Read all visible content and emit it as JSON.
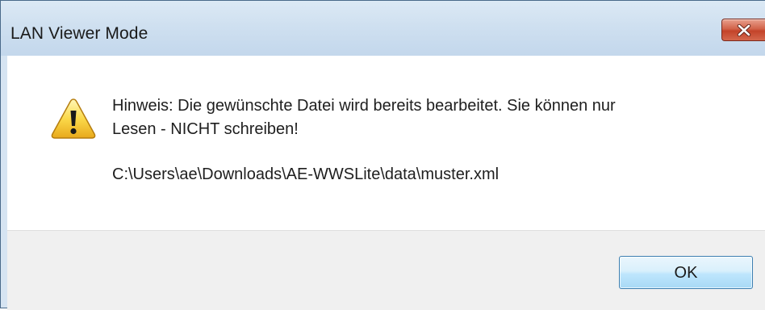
{
  "dialog": {
    "title": "LAN Viewer Mode",
    "message_line1": "Hinweis: Die gewünschte Datei wird bereits bearbeitet. Sie können nur",
    "message_line2": "Lesen - NICHT schreiben!",
    "file_path": "C:\\Users\\ae\\Downloads\\AE-WWSLite\\data\\muster.xml",
    "ok_label": "OK",
    "icons": {
      "close": "close-icon",
      "warning": "warning-icon"
    },
    "colors": {
      "titlebar": "#cfe0f0",
      "close_button": "#c3432a",
      "footer": "#f0f0f0",
      "ok_button_border": "#3c7fb1"
    }
  }
}
